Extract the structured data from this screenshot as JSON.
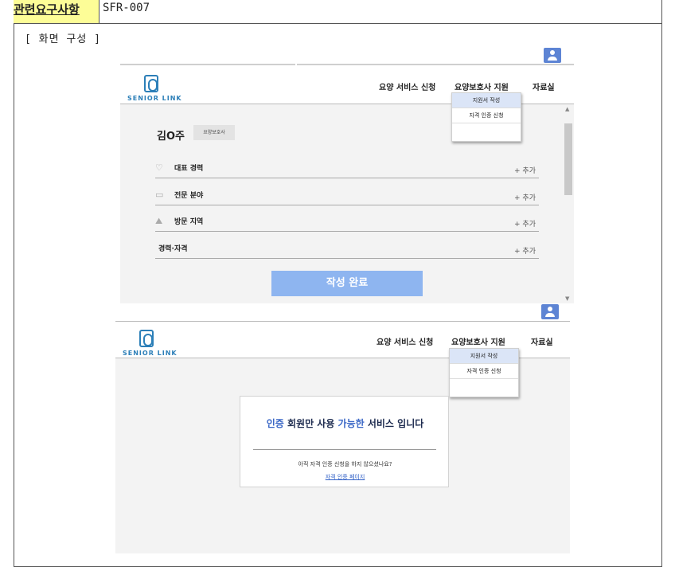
{
  "requirement": {
    "label": "관련요구사항",
    "value": "SFR-007"
  },
  "section_title": "[ 화면 구성 ]",
  "brand": {
    "logo_text": "SENIOR LINK"
  },
  "nav": {
    "service_apply": "요양 서비스 신청",
    "caregiver_support": "요양보호사 지원",
    "resources": "자료실"
  },
  "dropdown": {
    "items": [
      "지원서 작성",
      "자격 인증 신청"
    ],
    "selected_index": 0
  },
  "profile": {
    "name": "김O주",
    "role_badge": "요양보호사",
    "rows": [
      {
        "icon": "trophy-icon",
        "label": "대표 경력",
        "action": "+ 추가"
      },
      {
        "icon": "briefcase-icon",
        "label": "전문 분야",
        "action": "+ 추가"
      },
      {
        "icon": "map-icon",
        "label": "방문 지역",
        "action": "+ 추가"
      },
      {
        "icon": "",
        "label": "경력·자격",
        "action": "+ 추가"
      }
    ],
    "submit_label": "작성 완료"
  },
  "notice": {
    "title_part1": "인증",
    "title_part2": " 회원만 사용 ",
    "title_part3": "가능한",
    "title_part4": " 서비스 입니다",
    "subtitle": "아직 자격 인증 신청을 하지 않으셨나요?",
    "link": "자격 인증 페이지"
  },
  "colors": {
    "accent": "#5d84d4",
    "button": "#8eb5f0",
    "highlight": "#fdfd97",
    "link": "#2f5fc6"
  }
}
